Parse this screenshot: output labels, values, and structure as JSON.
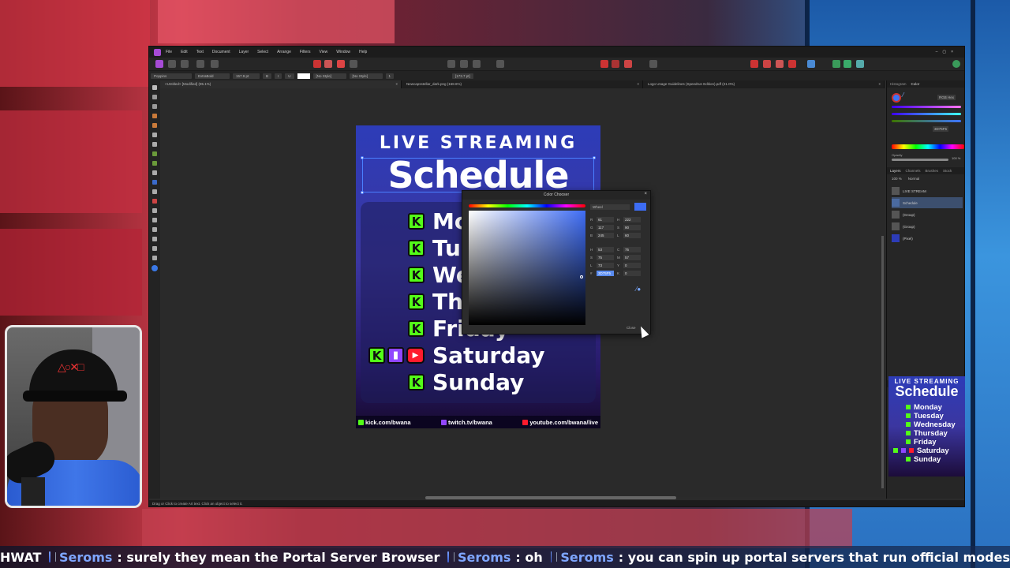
{
  "app": {
    "menu": [
      "File",
      "Edit",
      "Text",
      "Document",
      "Layer",
      "Select",
      "Arrange",
      "Filters",
      "View",
      "Window",
      "Help"
    ],
    "context_bar": {
      "font": "Poppins",
      "style": "ExtraBold",
      "size": "157.9 pt",
      "char_style": "[No Style]",
      "para_style": "[No Style]",
      "leading": "1",
      "tracking": "[173.7 pt]"
    },
    "tabs": [
      {
        "label": "<Untitled> [Modified] (95.1%)"
      },
      {
        "label": "Newcapsstellar_dark.png (168.6%)"
      },
      {
        "label": "Logo Usage Guidelines (Speedrun Edition).pdf (21.0%)"
      }
    ],
    "status": "Drag or Click to create Art text. Click an object to select it.",
    "right_panel": {
      "top_tabs": [
        "Histogram",
        "Color"
      ],
      "mode": "RGB Hex",
      "hex": "3D75F5",
      "opacity_label": "Opacity",
      "opacity": "100 %",
      "layer_tabs": [
        "Layers",
        "Channels",
        "Brushes",
        "Stock"
      ],
      "layer_opacity": "100 %",
      "blend_mode": "Normal",
      "layers": [
        "LIVE STREAM",
        "Schedule",
        "(Group)",
        "(Group)",
        "(Pixel)"
      ],
      "nav_tabs": [
        "Navigator",
        "Transform",
        "History"
      ],
      "zoom": "95 %"
    }
  },
  "artwork": {
    "title_line1": "LIVE STREAMING",
    "title_line2": "Schedule",
    "days": [
      "Mo",
      "Tu",
      "We",
      "Th",
      "Friday",
      "Saturday",
      "Sunday"
    ],
    "footer": {
      "kick": "kick.com/bwana",
      "twitch": "twitch.tv/bwana",
      "youtube": "youtube.com/bwana/live"
    }
  },
  "color_chooser": {
    "title": "Color Chooser",
    "mode": "Wheel",
    "fields": {
      "R": "61",
      "G": "117",
      "B": "245",
      "H": "222",
      "S": "90",
      "L": "60",
      "C": "75",
      "M": "57",
      "Y": "0",
      "K": "0",
      "HSL_H": "53",
      "HSL_S": "75",
      "HSL_L": "73",
      "hex": "3D75F5"
    },
    "close_label": "Close"
  },
  "preview": {
    "title_line1": "LIVE STREAMING",
    "title_line2": "Schedule",
    "days": [
      "Monday",
      "Tuesday",
      "Wednesday",
      "Thursday",
      "Friday",
      "Saturday",
      "Sunday"
    ]
  },
  "ticker": {
    "messages": [
      {
        "user": "",
        "text": "HWAT"
      },
      {
        "user": "Seroms",
        "text": "surely they mean the Portal Server Browser"
      },
      {
        "user": "Seroms",
        "text": "oh"
      },
      {
        "user": "Seroms",
        "text": "you can spin up portal servers that run official modes"
      }
    ]
  },
  "colors": {
    "kick": "#53fc18",
    "twitch": "#9146ff",
    "youtube": "#ff1b2d",
    "accent": "#3d75f5"
  }
}
